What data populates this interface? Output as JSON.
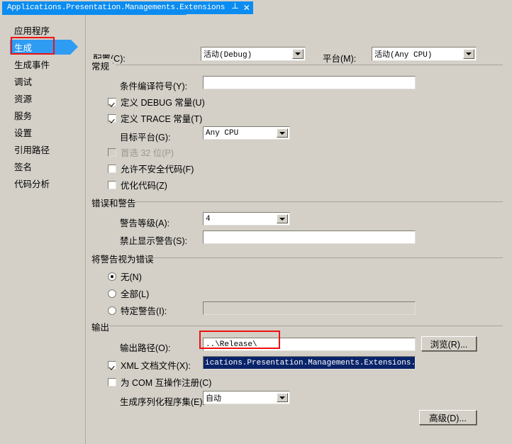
{
  "window": {
    "tab_title": "Applications.Presentation.Managements.Extensions",
    "pin_icon": "pin-icon",
    "close_icon": "close-icon"
  },
  "sidebar": {
    "items": [
      {
        "label": "应用程序",
        "selected": false
      },
      {
        "label": "生成",
        "selected": true
      },
      {
        "label": "生成事件",
        "selected": false
      },
      {
        "label": "调试",
        "selected": false
      },
      {
        "label": "资源",
        "selected": false
      },
      {
        "label": "服务",
        "selected": false
      },
      {
        "label": "设置",
        "selected": false
      },
      {
        "label": "引用路径",
        "selected": false
      },
      {
        "label": "签名",
        "selected": false
      },
      {
        "label": "代码分析",
        "selected": false
      }
    ]
  },
  "top": {
    "configuration_label": "配置(C):",
    "configuration_value": "活动(Debug)",
    "platform_label": "平台(M):",
    "platform_value": "活动(Any CPU)"
  },
  "general": {
    "title": "常规",
    "conditional_symbols_label": "条件编译符号(Y):",
    "conditional_symbols_value": "",
    "define_debug_label": "定义 DEBUG 常量(U)",
    "define_debug_checked": true,
    "define_trace_label": "定义 TRACE 常量(T)",
    "define_trace_checked": true,
    "target_platform_label": "目标平台(G):",
    "target_platform_value": "Any CPU",
    "prefer32_label": "首选 32 位(P)",
    "prefer32_checked": false,
    "allow_unsafe_label": "允许不安全代码(F)",
    "allow_unsafe_checked": false,
    "optimize_label": "优化代码(Z)",
    "optimize_checked": false
  },
  "errors": {
    "title": "错误和警告",
    "warning_level_label": "警告等级(A):",
    "warning_level_value": "4",
    "suppress_warnings_label": "禁止显示警告(S):",
    "suppress_warnings_value": ""
  },
  "warn_as_error": {
    "title": "将警告视为错误",
    "none_label": "无(N)",
    "all_label": "全部(L)",
    "specific_label": "特定警告(I):",
    "specific_value": "",
    "selected": "none"
  },
  "output": {
    "title": "输出",
    "output_path_label": "输出路径(O):",
    "output_path_value": "..\\Release\\",
    "browse_label": "浏览(R)...",
    "xml_doc_label": "XML 文档文件(X):",
    "xml_doc_checked": true,
    "xml_doc_value": "ications.Presentation.Managements.Extensions.XML",
    "com_interop_label": "为 COM 互操作注册(C)",
    "com_interop_checked": false,
    "serialization_label": "生成序列化程序集(E):",
    "serialization_value": "自动",
    "advanced_label": "高级(D)..."
  },
  "colors": {
    "face": "#d4d0c8",
    "tab_blue": "#0a8cf0",
    "select_blue": "#2f9cf4",
    "annotation_red": "#ee1111",
    "text_select": "#0a246a"
  }
}
